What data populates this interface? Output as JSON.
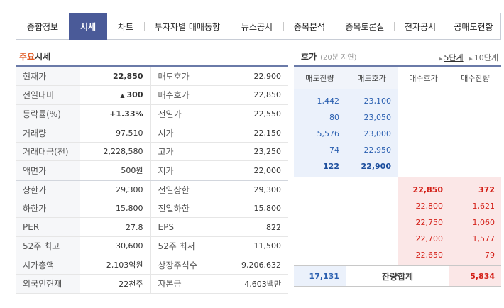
{
  "tabs": [
    {
      "label": "종합정보",
      "w": 74
    },
    {
      "label": "시세",
      "w": 54
    },
    {
      "label": "차트",
      "w": 52
    },
    {
      "label": "투자자별 매매동향",
      "w": 122
    },
    {
      "label": "뉴스공시",
      "w": 74
    },
    {
      "label": "종목분석",
      "w": 74
    },
    {
      "label": "종목토론실",
      "w": 82
    },
    {
      "label": "전자공시",
      "w": 74
    },
    {
      "label": "공매도현황",
      "w": 78
    }
  ],
  "main_quote": {
    "title_accent": "주요",
    "title_rest": "시세",
    "rows": [
      {
        "l1": "현재가",
        "v1": "22,850",
        "l2": "매도호가",
        "v2": "22,900"
      },
      {
        "l1": "전일대비",
        "v1": "300",
        "l2": "매수호가",
        "v2": "22,850"
      },
      {
        "l1": "등락률(%)",
        "v1": "+1.33%",
        "l2": "전일가",
        "v2": "22,550"
      },
      {
        "l1": "거래량",
        "v1": "97,510",
        "l2": "시가",
        "v2": "22,150"
      },
      {
        "l1": "거래대금(천)",
        "v1": "2,228,580",
        "l2": "고가",
        "v2": "23,250"
      },
      {
        "l1": "액면가",
        "v1": "500원",
        "l2": "저가",
        "v2": "22,000"
      },
      {
        "l1": "상한가",
        "v1": "29,300",
        "l2": "전일상한",
        "v2": "29,300"
      },
      {
        "l1": "하한가",
        "v1": "15,800",
        "l2": "전일하한",
        "v2": "15,800"
      },
      {
        "l1": "PER",
        "v1": "27.8",
        "l2": "EPS",
        "v2": "822"
      },
      {
        "l1": "52주 최고",
        "v1": "30,600",
        "l2": "52주 최저",
        "v2": "11,500"
      },
      {
        "l1": "시가총액",
        "v1": "2,103억원",
        "l2": "상장주식수",
        "v2": "9,206,632"
      },
      {
        "l1": "외국인현재",
        "v1": "22천주",
        "l2": "자본금",
        "v2": "4,603백만"
      }
    ]
  },
  "hoga": {
    "title": "호가",
    "subtitle": "(20분 지연)",
    "step5": "5단계",
    "step10": "10단계",
    "headers": [
      "매도잔량",
      "매도호가",
      "매수호가",
      "매수잔량"
    ],
    "asks": [
      {
        "qty": "1,442",
        "price": "23,100"
      },
      {
        "qty": "80",
        "price": "23,050"
      },
      {
        "qty": "5,576",
        "price": "23,000"
      },
      {
        "qty": "74",
        "price": "22,950"
      },
      {
        "qty": "122",
        "price": "22,900"
      }
    ],
    "bids": [
      {
        "price": "22,850",
        "qty": "372"
      },
      {
        "price": "22,800",
        "qty": "1,621"
      },
      {
        "price": "22,750",
        "qty": "1,060"
      },
      {
        "price": "22,700",
        "qty": "1,577"
      },
      {
        "price": "22,650",
        "qty": "79"
      }
    ],
    "total_ask": "17,131",
    "total_label": "잔량합계",
    "total_bid": "5,834"
  },
  "colors": {
    "tab_active": "#4a5a98",
    "up": "#d4221a",
    "ask_blue": "#2a5fb0",
    "title_accent": "#e05a24"
  }
}
